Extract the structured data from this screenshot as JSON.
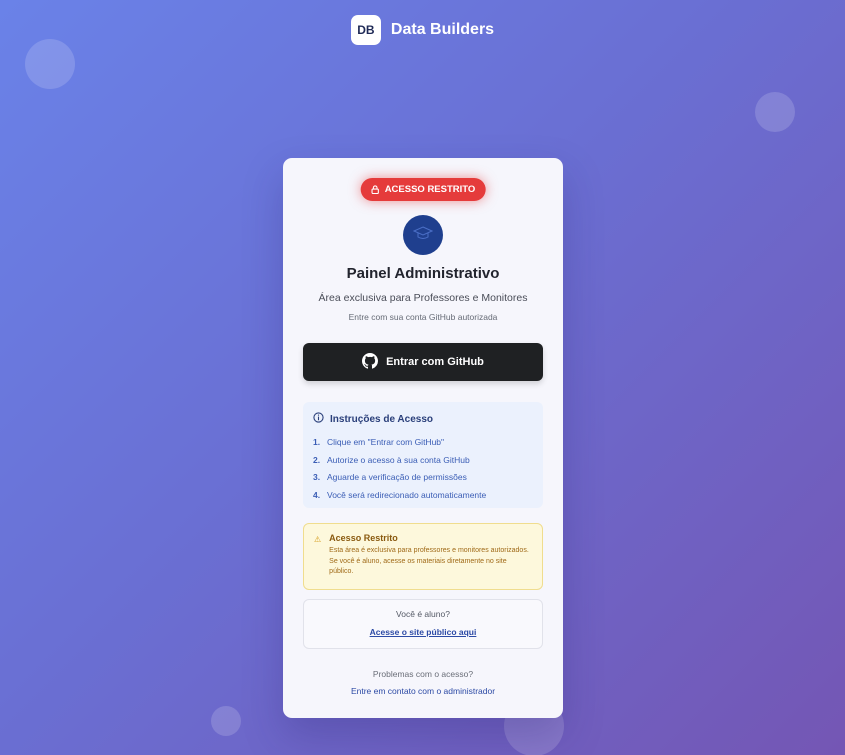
{
  "brand": {
    "logo_text": "DB",
    "name": "Data Builders"
  },
  "card": {
    "badge": {
      "icon": "lock-icon",
      "label": "ACESSO RESTRITO"
    },
    "avatar_icon": "graduation-cap-icon",
    "title": "Painel Administrativo",
    "subtitle": "Área exclusiva para Professores e Monitores",
    "hint": "Entre com sua conta GitHub autorizada",
    "github_button": {
      "icon": "github-icon",
      "label": "Entrar com GitHub"
    },
    "instructions": {
      "icon": "info-icon",
      "title": "Instruções de Acesso",
      "items": [
        {
          "num": "1.",
          "text": "Clique em \"Entrar com GitHub\""
        },
        {
          "num": "2.",
          "text": "Autorize o acesso à sua conta GitHub"
        },
        {
          "num": "3.",
          "text": "Aguarde a verificação de permissões"
        },
        {
          "num": "4.",
          "text": "Você será redirecionado automaticamente"
        }
      ]
    },
    "warning": {
      "icon": "warning-icon",
      "title": "Acesso Restrito",
      "text": "Esta área é exclusiva para professores e monitores autorizados. Se você é aluno, acesse os materiais diretamente no site público."
    },
    "student": {
      "question": "Você é aluno?",
      "link": "Acesse o site público aqui"
    },
    "help": {
      "question": "Problemas com o acesso?",
      "link": "Entre em contato com o administrador"
    }
  },
  "colors": {
    "background_start": "#6a82e8",
    "background_end": "#7456b4",
    "badge": "#e53b3b",
    "github_button": "#1f2123",
    "link": "#2c4aa5"
  }
}
